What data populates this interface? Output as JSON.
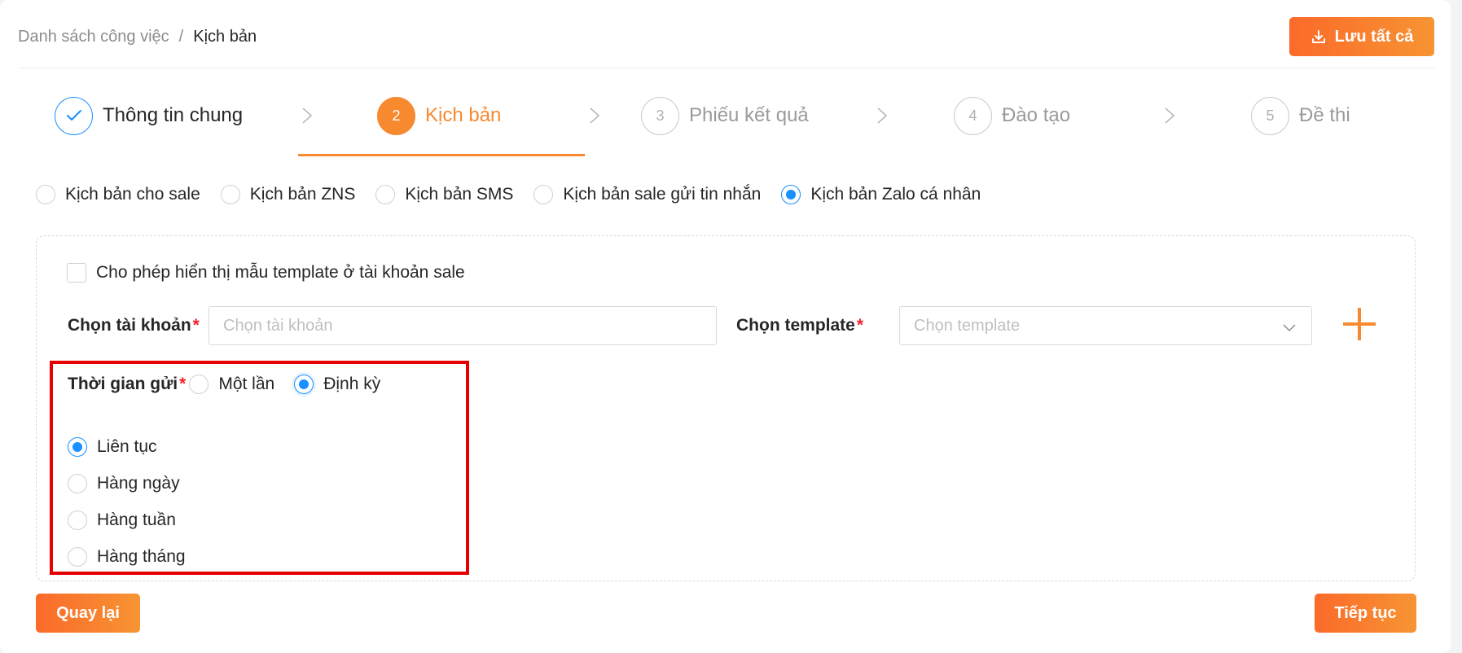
{
  "breadcrumb": {
    "parent": "Danh sách công việc",
    "separator": "/",
    "current": "Kịch bản"
  },
  "header": {
    "save_all_label": "Lưu tất cả",
    "save_icon": "download-icon"
  },
  "steps": [
    {
      "number": "1",
      "label": "Thông tin chung",
      "status": "done",
      "icon": "check-icon"
    },
    {
      "number": "2",
      "label": "Kịch bản",
      "status": "active"
    },
    {
      "number": "3",
      "label": "Phiếu kết quả",
      "status": "wait"
    },
    {
      "number": "4",
      "label": "Đào tạo",
      "status": "wait"
    },
    {
      "number": "5",
      "label": "Đề thi",
      "status": "wait"
    }
  ],
  "script_types": [
    {
      "label": "Kịch bản cho sale",
      "checked": false
    },
    {
      "label": "Kịch bản ZNS",
      "checked": false
    },
    {
      "label": "Kịch bản SMS",
      "checked": false
    },
    {
      "label": "Kịch bản sale gửi tin nhắn",
      "checked": false
    },
    {
      "label": "Kịch bản Zalo cá nhân",
      "checked": true
    }
  ],
  "form": {
    "show_template_checkbox": {
      "label": "Cho phép hiển thị mẫu template ở tài khoản sale",
      "checked": false
    },
    "account": {
      "label": "Chọn tài khoản",
      "required_mark": "*",
      "placeholder": "Chọn tài khoản",
      "value": ""
    },
    "template": {
      "label": "Chọn template",
      "required_mark": "*",
      "placeholder": "Chọn template",
      "value": ""
    },
    "add_icon": "plus-icon",
    "send_time": {
      "label": "Thời gian gửi",
      "required_mark": "*",
      "options": [
        {
          "label": "Một lần",
          "checked": false
        },
        {
          "label": "Định kỳ",
          "checked": true
        }
      ]
    },
    "frequency": [
      {
        "label": "Liên tục",
        "checked": true
      },
      {
        "label": "Hàng ngày",
        "checked": false
      },
      {
        "label": "Hàng tuần",
        "checked": false
      },
      {
        "label": "Hàng tháng",
        "checked": false
      }
    ]
  },
  "footer": {
    "back_label": "Quay lại",
    "next_label": "Tiếp tục"
  },
  "colors": {
    "accent": "#f7892f",
    "primary": "#1890ff",
    "required": "#f5222d",
    "highlight": "#e60000"
  }
}
